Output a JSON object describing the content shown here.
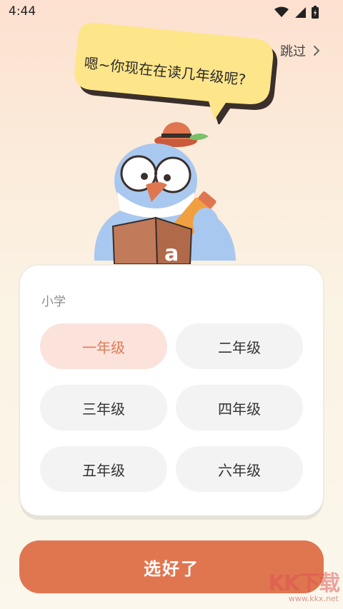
{
  "status_bar": {
    "time": "4:44"
  },
  "skip": {
    "label": "跳过"
  },
  "bubble": {
    "text": "嗯~你现在在读几年级呢?"
  },
  "mascot": {
    "book_letter": "a"
  },
  "grade_card": {
    "section_label": "小学",
    "options": [
      {
        "label": "一年级",
        "selected": true
      },
      {
        "label": "二年级",
        "selected": false
      },
      {
        "label": "三年级",
        "selected": false
      },
      {
        "label": "四年级",
        "selected": false
      },
      {
        "label": "五年级",
        "selected": false
      },
      {
        "label": "六年级",
        "selected": false
      }
    ]
  },
  "confirm": {
    "label": "选好了"
  },
  "watermark": {
    "logo": "KK下载",
    "url": "www.kkx.net"
  },
  "colors": {
    "accent": "#e07650",
    "selected_bg": "#fbe3dc",
    "selected_text": "#e07a55",
    "bubble_yellow": "#fde58a",
    "mascot_blue": "#a9c8f0"
  }
}
